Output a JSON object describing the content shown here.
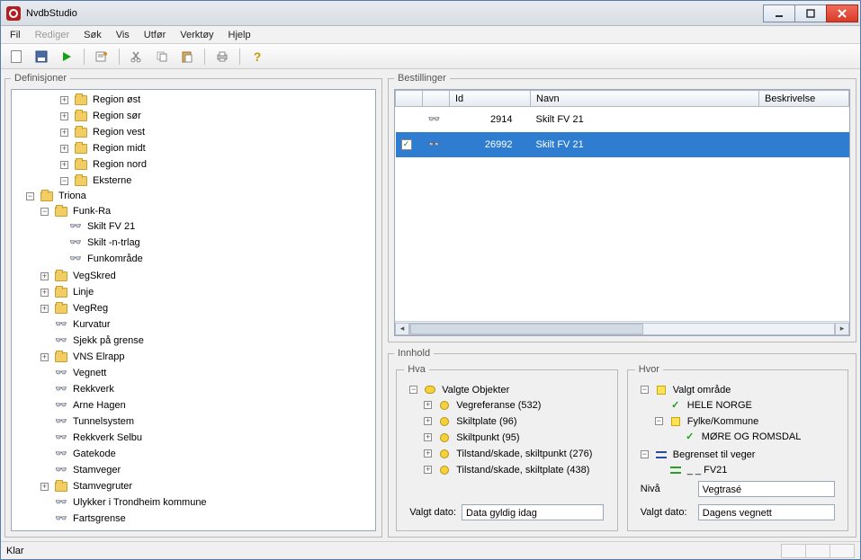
{
  "window": {
    "title": "NvdbStudio"
  },
  "menu": {
    "fil": "Fil",
    "rediger": "Rediger",
    "sok": "Søk",
    "vis": "Vis",
    "utfor": "Utfør",
    "verktoy": "Verktøy",
    "hjelp": "Hjelp"
  },
  "panels": {
    "definisjoner": "Definisjoner",
    "bestillinger": "Bestillinger",
    "innhold": "Innhold",
    "hva": "Hva",
    "hvor": "Hvor"
  },
  "tree": {
    "region_ost": "Region øst",
    "region_sor": "Region sør",
    "region_vest": "Region vest",
    "region_midt": "Region midt",
    "region_nord": "Region nord",
    "eksterne": "Eksterne",
    "triona": "Triona",
    "funk_ra": "Funk-Ra",
    "skilt_fv21": "Skilt FV 21",
    "skilt_n_trlag": "Skilt -n-trlag",
    "funkomrade": "Funkområde",
    "vegskred": "VegSkred",
    "linje": "Linje",
    "vegreg": "VegReg",
    "kurvatur": "Kurvatur",
    "sjekk_grense": "Sjekk på grense",
    "vns_elrapp": "VNS Elrapp",
    "vegnett": "Vegnett",
    "rekkverk": "Rekkverk",
    "arne_hagen": "Arne Hagen",
    "tunnel": "Tunnelsystem",
    "rekkverk_selbu": "Rekkverk Selbu",
    "gatekode": "Gatekode",
    "stamveger": "Stamveger",
    "stamvegruter": "Stamvegruter",
    "ulykker": "Ulykker i Trondheim kommune",
    "fartsgrense": "Fartsgrense"
  },
  "orders": {
    "cols": {
      "blank": "",
      "id": "Id",
      "navn": "Navn",
      "beskrivelse": "Beskrivelse"
    },
    "row1": {
      "id": "2914",
      "navn": "Skilt FV 21"
    },
    "row2": {
      "id": "26992",
      "navn": "Skilt FV 21"
    }
  },
  "hva": {
    "root": "Valgte Objekter",
    "vegref": "Vegreferanse (532)",
    "skiltplate": "Skiltplate (96)",
    "skiltpunkt": "Skiltpunkt (95)",
    "ts_punkt": "Tilstand/skade, skiltpunkt (276)",
    "ts_plate": "Tilstand/skade, skiltplate (438)",
    "valgt_dato_label": "Valgt dato:",
    "valgt_dato_value": "Data gyldig idag"
  },
  "hvor": {
    "valgt_omrade": "Valgt område",
    "hele_norge": "HELE NORGE",
    "fylke_kommune": "Fylke/Kommune",
    "more_romsdal": "MØRE OG ROMSDAL",
    "begrenset": "Begrenset til veger",
    "fv21": "_ _ FV21",
    "niva_label": "Nivå",
    "niva_value": "Vegtrasé",
    "valgt_dato_label": "Valgt dato:",
    "valgt_dato_value": "Dagens vegnett"
  },
  "status": {
    "text": "Klar"
  }
}
